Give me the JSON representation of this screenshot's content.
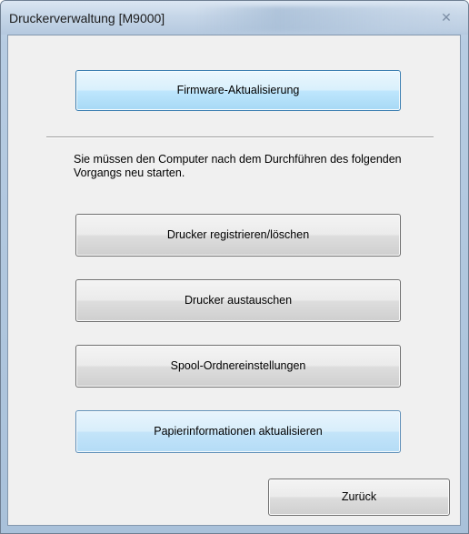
{
  "window": {
    "title": "Druckerverwaltung [M9000]",
    "close_icon": "close-icon"
  },
  "buttons": {
    "firmware_update": "Firmware-Aktualisierung",
    "register_delete_printer": "Drucker registrieren/löschen",
    "replace_printer": "Drucker austauschen",
    "spool_folder_settings": "Spool-Ordnereinstellungen",
    "update_paper_info": "Papierinformationen aktualisieren",
    "back": "Zurück"
  },
  "notice": {
    "restart_required": "Sie müssen den Computer nach dem Durchführen des folgenden Vorgangs neu starten."
  },
  "colors": {
    "button_highlight_border": "#3c7fb1",
    "button_highlight_fill": "#bee6fd",
    "dialog_background": "#f0f0f0",
    "window_frame": "#b5c9df"
  }
}
